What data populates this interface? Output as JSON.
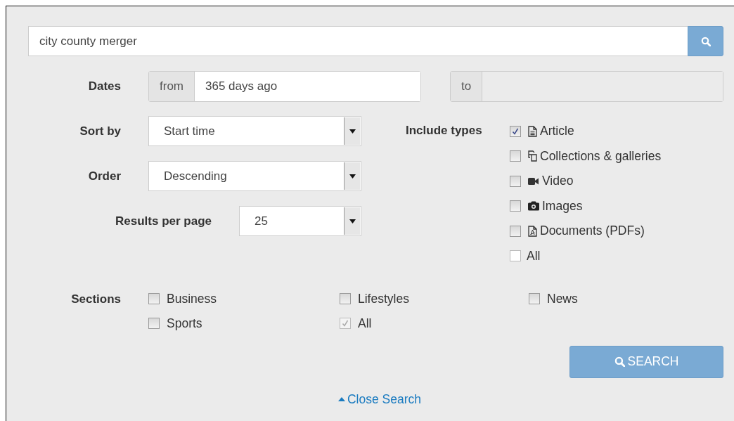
{
  "search": {
    "value": "city county merger"
  },
  "dates": {
    "label": "Dates",
    "from_label": "from",
    "from_value": "365 days ago",
    "to_label": "to"
  },
  "selects": [
    {
      "label": "Sort by",
      "value": "Start time",
      "kind": "wide"
    },
    {
      "label": "Order",
      "value": "Descending",
      "kind": "wide"
    },
    {
      "label": "Results per page",
      "value": "25",
      "kind": "narrow"
    }
  ],
  "include_types": {
    "label": "Include types",
    "items": [
      {
        "label": "Article",
        "kind": "document",
        "checked": true
      },
      {
        "label": "Collections & galleries",
        "kind": "collection",
        "checked": false
      },
      {
        "label": "Video",
        "kind": "video",
        "checked": false
      },
      {
        "label": "Images",
        "kind": "camera",
        "checked": false
      },
      {
        "label": "Documents (PDFs)",
        "kind": "pdf",
        "checked": false
      },
      {
        "label": "All",
        "kind": "plain",
        "checked": false
      }
    ]
  },
  "sections": {
    "label": "Sections",
    "items": [
      {
        "label": "Business",
        "checked": false,
        "disabled": false
      },
      {
        "label": "Lifestyles",
        "checked": false,
        "disabled": false
      },
      {
        "label": "News",
        "checked": false,
        "disabled": false
      },
      {
        "label": "Sports",
        "checked": false,
        "disabled": false
      },
      {
        "label": "All",
        "checked": true,
        "disabled": true
      }
    ]
  },
  "search_button": "SEARCH",
  "close_link": "Close Search"
}
